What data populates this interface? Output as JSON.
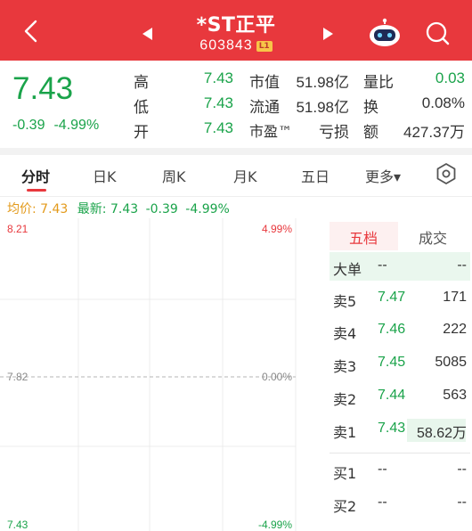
{
  "header": {
    "title": "*ST正平",
    "code": "603843",
    "badge": "L1"
  },
  "quote": {
    "price": "7.43",
    "change": "-0.39",
    "change_pct": "-4.99%",
    "stats": [
      {
        "label": "高",
        "value": "7.43",
        "color": "green"
      },
      {
        "label": "低",
        "value": "7.43",
        "color": "green"
      },
      {
        "label": "开",
        "value": "7.43",
        "color": "green"
      },
      {
        "label": "市值",
        "value": "51.98亿",
        "color": "dark"
      },
      {
        "label": "流通",
        "value": "51.98亿",
        "color": "dark"
      },
      {
        "label": "市盈™",
        "value": "亏损",
        "color": "dark"
      },
      {
        "label": "量比",
        "value": "0.03",
        "color": "green"
      },
      {
        "label": "换",
        "value": "0.08%",
        "color": "dark"
      },
      {
        "label": "额",
        "value": "427.37万",
        "color": "dark"
      }
    ]
  },
  "tabs": [
    {
      "label": "分时",
      "active": true
    },
    {
      "label": "日K",
      "active": false
    },
    {
      "label": "周K",
      "active": false
    },
    {
      "label": "月K",
      "active": false
    },
    {
      "label": "五日",
      "active": false
    },
    {
      "label": "更多▾",
      "active": false
    }
  ],
  "info": {
    "avg_label": "均价:",
    "avg_value": "7.43",
    "latest_label": "最新:",
    "latest_value": "7.43",
    "latest_change": "-0.39",
    "latest_pct": "-4.99%"
  },
  "chart_data": {
    "type": "line",
    "title": "",
    "y_labels_left": [
      "8.21",
      "7.82",
      "7.43"
    ],
    "y_labels_right": [
      "4.99%",
      "0.00%",
      "-4.99%"
    ],
    "ylim": [
      7.43,
      8.21
    ],
    "prev_close": 7.82,
    "series": []
  },
  "orderbook": {
    "tabs": [
      "五档",
      "成交"
    ],
    "big_order": {
      "label": "大单",
      "price": "--",
      "volume": "--"
    },
    "asks": [
      {
        "label": "卖5",
        "price": "7.47",
        "volume": "171"
      },
      {
        "label": "卖4",
        "price": "7.46",
        "volume": "222"
      },
      {
        "label": "卖3",
        "price": "7.45",
        "volume": "5085"
      },
      {
        "label": "卖2",
        "price": "7.44",
        "volume": "563"
      },
      {
        "label": "卖1",
        "price": "7.43",
        "volume": "58.62万"
      }
    ],
    "bids": [
      {
        "label": "买1",
        "price": "--",
        "volume": "--"
      },
      {
        "label": "买2",
        "price": "--",
        "volume": "--"
      }
    ]
  },
  "colors": {
    "header_bg": "#e8383d",
    "down_green": "#1aa34a",
    "avg_orange": "#e39a1b",
    "up_red": "#e8383d"
  },
  "icons": [
    "back-icon",
    "prev-arrow-icon",
    "next-arrow-icon",
    "robot-icon",
    "search-icon",
    "settings-icon"
  ]
}
